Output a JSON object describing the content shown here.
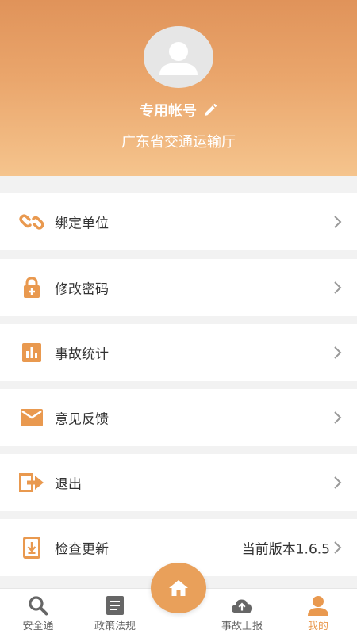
{
  "profile": {
    "account_label": "专用帐号",
    "organization": "广东省交通运输厅"
  },
  "menu": [
    {
      "label": "绑定单位",
      "icon": "link-icon"
    },
    {
      "label": "修改密码",
      "icon": "lock-icon"
    },
    {
      "label": "事故统计",
      "icon": "bar-chart-icon"
    },
    {
      "label": "意见反馈",
      "icon": "mail-icon"
    },
    {
      "label": "退出",
      "icon": "logout-icon"
    },
    {
      "label": "检查更新",
      "icon": "download-icon",
      "value": "当前版本1.6.5"
    }
  ],
  "tabs": [
    {
      "label": "安全通",
      "icon": "search-icon"
    },
    {
      "label": "政策法规",
      "icon": "document-icon"
    },
    {
      "label": "事故上报",
      "icon": "cloud-upload-icon"
    },
    {
      "label": "我的",
      "icon": "person-icon",
      "active": true
    }
  ],
  "colors": {
    "accent": "#e9994f",
    "header_top": "#e0935a",
    "header_bottom": "#f5c48d"
  }
}
